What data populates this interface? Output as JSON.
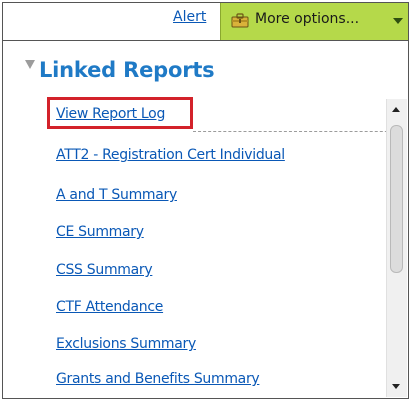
{
  "toolbar": {
    "alert_label": "Alert",
    "more_options_label": "More options...",
    "more_options_color": "#b5d94a"
  },
  "section": {
    "title": "Linked Reports",
    "title_color": "#1f7ac6",
    "collapse_icon": "triangle-down-icon"
  },
  "reports": [
    {
      "label": "View Report Log",
      "highlighted": true
    },
    {
      "label": "ATT2 - Registration Cert Individual"
    },
    {
      "label": "A and T Summary"
    },
    {
      "label": "CE Summary"
    },
    {
      "label": "CSS Summary"
    },
    {
      "label": "CTF Attendance"
    },
    {
      "label": "Exclusions Summary"
    },
    {
      "label": "Grants and Benefits Summary"
    }
  ],
  "colors": {
    "link": "#0a58b6",
    "highlight_border": "#d3222a"
  }
}
